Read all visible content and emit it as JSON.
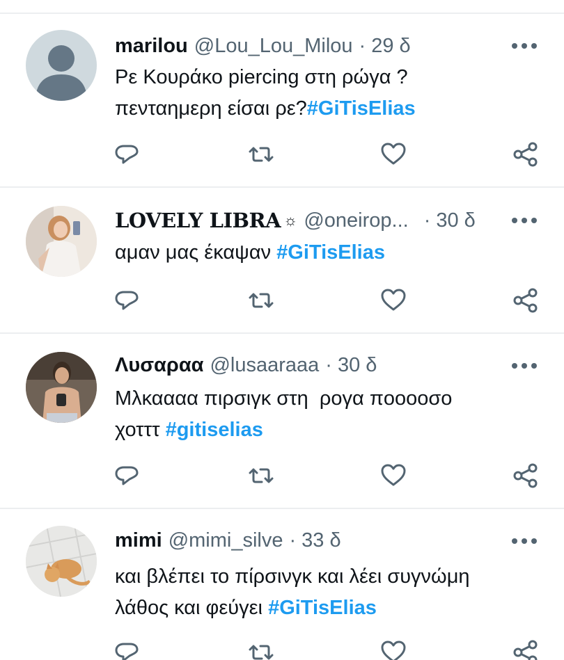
{
  "colors": {
    "text": "#0f1419",
    "secondary": "#536471",
    "link": "#1d9bf0",
    "divider": "#eceef0"
  },
  "icons": {
    "reply": "reply-icon",
    "retweet": "retweet-icon",
    "like": "like-icon",
    "share": "share-icon",
    "more": "more-icon"
  },
  "tweets": [
    {
      "name": "marilou",
      "handle": "@Lou_Lou_Milou",
      "dot": "·",
      "time": "29 δ",
      "lines": [
        {
          "text": "Ρε Κουράκο piercing στη ρώγα ?",
          "hashtag": ""
        },
        {
          "text": "πενταημερη είσαι ρε?",
          "hashtag": "#GiTisElias"
        }
      ]
    },
    {
      "name": "LOVELY LIBRA",
      "name_symbol": "☼",
      "handle": "@oneirop...",
      "dot": "·",
      "time": "30 δ",
      "lines": [
        {
          "text": "αμαν μας έκαψαν ",
          "hashtag": "#GiTisElias"
        }
      ]
    },
    {
      "name": "Λυσαραα",
      "handle": "@lusaaraaa",
      "dot": "·",
      "time": "30 δ",
      "lines": [
        {
          "text": "Μλκαααα πιρσιγκ στη  ρογα πoooοσο",
          "hashtag": ""
        },
        {
          "text": "χοτττ ",
          "hashtag": "#gitiselias"
        }
      ]
    },
    {
      "name": "mimi",
      "handle": "@mimi_silve",
      "dot": "·",
      "time": "33 δ",
      "lines": [
        {
          "text": "και βλέπει το πίρσινγκ και λέει συγνώμη",
          "hashtag": ""
        },
        {
          "text": "λάθος και φεύγει ",
          "hashtag": "#GiTisElias"
        }
      ]
    }
  ]
}
